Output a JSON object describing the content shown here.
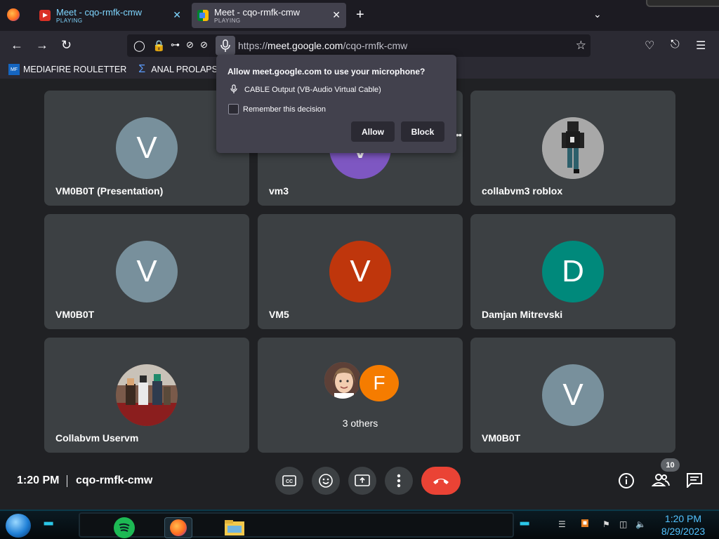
{
  "browser": {
    "tabs": [
      {
        "title": "Meet - cqo-rmfk-cmw",
        "status": "PLAYING",
        "favicon": "red-play-icon",
        "color": "#7fd6ff"
      },
      {
        "title": "Meet - cqo-rmfk-cmw",
        "status": "PLAYING",
        "favicon": "meet-icon",
        "active": true
      }
    ],
    "url_prefix": "https://",
    "url_domain": "meet.google.com",
    "url_path": "/cqo-rmfk-cmw",
    "bookmarks": [
      {
        "label": "MEDIAFIRE ROULETTER",
        "icon": "mediafire-icon"
      },
      {
        "label": "ANAL PROLAPSE",
        "icon": "sigma-icon"
      }
    ]
  },
  "permission_popup": {
    "question": "Allow meet.google.com to use your microphone?",
    "device": "CABLE Output (VB-Audio Virtual Cable)",
    "remember_label": "Remember this decision",
    "remember_checked": false,
    "allow_label": "Allow",
    "block_label": "Block"
  },
  "participants": [
    {
      "name": "VM0B0T (Presentation)",
      "initial": "V",
      "color": "#78909c"
    },
    {
      "name": "vm3",
      "initial": "V",
      "color": "#7e57c2"
    },
    {
      "name": "collabvm3 roblox",
      "initial": "",
      "color": "#9e9e9e",
      "picture": "roblox-avatar"
    },
    {
      "name": "VM0B0T",
      "initial": "V",
      "color": "#78909c"
    },
    {
      "name": "VM5",
      "initial": "V",
      "color": "#bf360c"
    },
    {
      "name": "Damjan Mitrevski",
      "initial": "D",
      "color": "#00897b"
    },
    {
      "name": "Collabvm Uservm",
      "initial": "",
      "color": "#6d4c41",
      "picture": "group-photo"
    },
    {
      "name": "3 others",
      "initial": "F",
      "color": "#f57c00",
      "picture": "girl-photo"
    },
    {
      "name": "VM0B0T",
      "initial": "V",
      "color": "#78909c"
    }
  ],
  "meeting": {
    "time": "1:20 PM",
    "code": "cqo-rmfk-cmw",
    "people_count": "10"
  },
  "taskbar": {
    "time": "1:20 PM",
    "date": "8/29/2023"
  }
}
